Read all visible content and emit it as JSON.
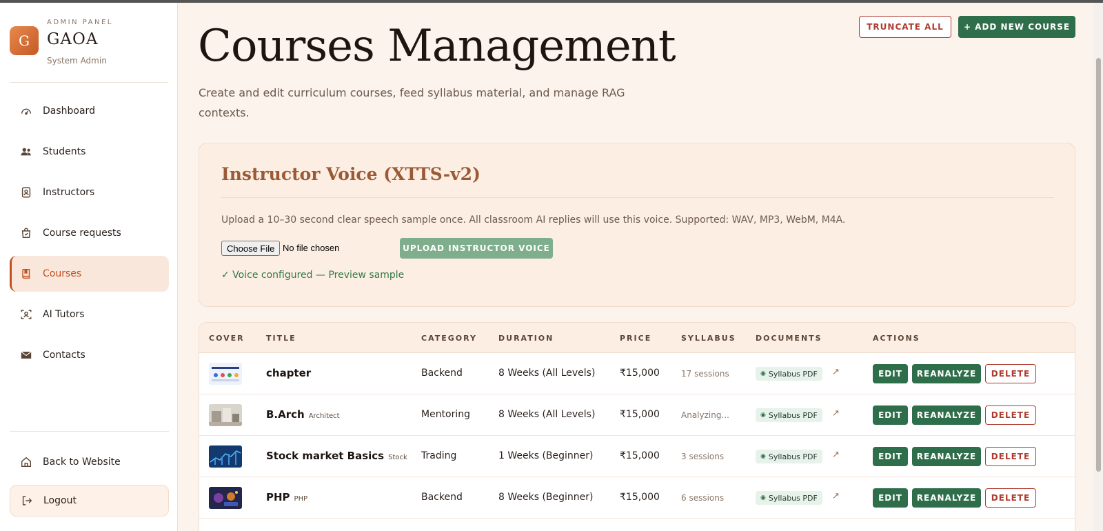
{
  "brand": {
    "kicker": "ADMIN PANEL",
    "logo_letter": "G",
    "name": "GAOA",
    "role": "System Admin"
  },
  "sidebar": {
    "items": [
      {
        "label": "Dashboard",
        "icon": "dashboard-gauge-icon"
      },
      {
        "label": "Students",
        "icon": "users-icon"
      },
      {
        "label": "Instructors",
        "icon": "badge-icon"
      },
      {
        "label": "Course requests",
        "icon": "shopping-bag-icon"
      },
      {
        "label": "Courses",
        "icon": "book-icon",
        "active": true
      },
      {
        "label": "AI Tutors",
        "icon": "user-focus-icon"
      },
      {
        "label": "Contacts",
        "icon": "envelope-icon"
      }
    ],
    "bottom": [
      {
        "label": "Back to Website",
        "icon": "home-icon"
      },
      {
        "label": "Logout",
        "icon": "logout-icon"
      }
    ]
  },
  "header": {
    "title": "Courses Management",
    "subtitle": "Create and edit curriculum courses, feed syllabus material, and manage RAG contexts.",
    "truncate_label": "TRUNCATE ALL",
    "add_label": "+ ADD NEW COURSE"
  },
  "voice": {
    "title": "Instructor Voice (XTTS-v2)",
    "description": "Upload a 10–30 second clear speech sample once. All classroom AI replies will use this voice. Supported: WAV, MP3, WebM, M4A.",
    "file_button": "Choose File",
    "file_status": "No file chosen",
    "upload_label": "UPLOAD INSTRUCTOR VOICE",
    "status": "✓ Voice configured — Preview sample"
  },
  "table": {
    "headers": {
      "cover": "COVER",
      "title": "TITLE",
      "category": "CATEGORY",
      "duration": "DURATION",
      "price": "PRICE",
      "syllabus": "SYLLABUS",
      "documents": "DOCUMENTS",
      "actions": "ACTIONS"
    },
    "rows": [
      {
        "title": "chapter",
        "tag": "",
        "category": "Backend",
        "duration": "8 Weeks (All Levels)",
        "price": "₹15,000",
        "syllabus": "17 sessions",
        "doc": "Syllabus PDF",
        "cover_color": "#e9eef8"
      },
      {
        "title": "B.Arch",
        "tag": "Architect",
        "category": "Mentoring",
        "duration": "8 Weeks (All Levels)",
        "price": "₹15,000",
        "syllabus": "Analyzing...",
        "doc": "Syllabus PDF",
        "cover_color": "#c9c3bb"
      },
      {
        "title": "Stock market Basics",
        "tag": "Stock",
        "category": "Trading",
        "duration": "1 Weeks (Beginner)",
        "price": "₹15,000",
        "syllabus": "3 sessions",
        "doc": "Syllabus PDF",
        "cover_color": "#1f4f8a"
      },
      {
        "title": "PHP",
        "tag": "PHP",
        "category": "Backend",
        "duration": "8 Weeks (Beginner)",
        "price": "₹15,000",
        "syllabus": "6 sessions",
        "doc": "Syllabus PDF",
        "cover_color": "#2a2f5a"
      }
    ],
    "actions": {
      "edit": "EDIT",
      "reanalyze": "REANALYZE",
      "delete": "DELETE"
    },
    "edit_glyph": "↗",
    "eye_glyph": "◉"
  },
  "colors": {
    "accent": "#c2501c",
    "success": "#2e6e4a",
    "danger": "#b03a2e",
    "background": "#fbf3ec"
  }
}
